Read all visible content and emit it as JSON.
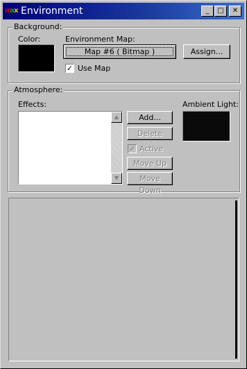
{
  "window": {
    "title": "Environment"
  },
  "titlebar_buttons": {
    "minimize": "_",
    "maximize": "□",
    "close": "✕"
  },
  "background": {
    "group_label": "Background:",
    "color_label": "Color:",
    "color_value": "#000000",
    "env_map_label": "Environment Map:",
    "env_map_button": "Map #6  ( Bitmap )",
    "assign_button": "Assign...",
    "use_map_label": "Use Map",
    "use_map_checked": true
  },
  "atmosphere": {
    "group_label": "Atmosphere:",
    "effects_label": "Effects:",
    "effects_items": [],
    "add_button": "Add...",
    "delete_button": "Delete",
    "active_label": "Active",
    "move_up_button": "Move Up",
    "move_down_button": "Move Down",
    "ambient_label": "Ambient Light:",
    "ambient_value": "#000000"
  },
  "icons": {
    "app": "3ds-max-environment-icon",
    "check": "checkmark"
  }
}
